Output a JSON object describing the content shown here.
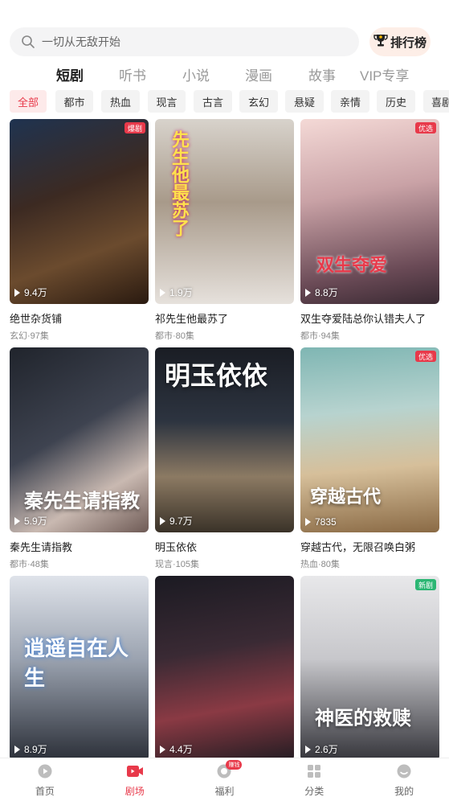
{
  "search": {
    "placeholder": "一切从无敌开始",
    "rank_label": "排行榜"
  },
  "main_tabs": [
    "短剧",
    "听书",
    "小说",
    "漫画",
    "故事",
    "VIP专享"
  ],
  "chips": [
    "全部",
    "都市",
    "热血",
    "现言",
    "古言",
    "玄幻",
    "悬疑",
    "亲情",
    "历史",
    "喜剧"
  ],
  "cards": [
    {
      "title": "绝世杂货铺",
      "meta": "玄幻·97集",
      "plays": "9.4万",
      "badge": "爆剧",
      "overlay": ""
    },
    {
      "title": "祁先生他最苏了",
      "meta": "都市·80集",
      "plays": "1.9万",
      "badge": "",
      "overlay": "先生他最苏了"
    },
    {
      "title": "双生夺爱陆总你认错夫人了",
      "meta": "都市·94集",
      "plays": "8.8万",
      "badge": "优选",
      "overlay": "双生夺爱"
    },
    {
      "title": "秦先生请指教",
      "meta": "都市·48集",
      "plays": "5.9万",
      "badge": "",
      "overlay": "秦先生请指教"
    },
    {
      "title": "明玉依依",
      "meta": "现言·105集",
      "plays": "9.7万",
      "badge": "",
      "overlay": "明玉依依"
    },
    {
      "title": "穿越古代，无限召唤白粥",
      "meta": "热血·80集",
      "plays": "7835",
      "badge": "优选",
      "overlay": "穿越古代"
    },
    {
      "title": "",
      "meta": "",
      "plays": "8.9万",
      "badge": "",
      "overlay": "逍遥自在人生"
    },
    {
      "title": "",
      "meta": "",
      "plays": "4.4万",
      "badge": "",
      "overlay": ""
    },
    {
      "title": "",
      "meta": "",
      "plays": "2.6万",
      "badge": "新剧",
      "overlay": "神医的救赎"
    }
  ],
  "nav": [
    {
      "label": "首页",
      "icon": "home-icon",
      "badge": ""
    },
    {
      "label": "剧场",
      "icon": "theater-icon",
      "badge": ""
    },
    {
      "label": "福利",
      "icon": "welfare-icon",
      "badge": "赚钱"
    },
    {
      "label": "分类",
      "icon": "category-icon",
      "badge": ""
    },
    {
      "label": "我的",
      "icon": "profile-icon",
      "badge": ""
    }
  ],
  "colors": {
    "accent": "#e8394a",
    "chip_bg": "#f3f3f3",
    "rank_bg": "#fdeee7"
  }
}
